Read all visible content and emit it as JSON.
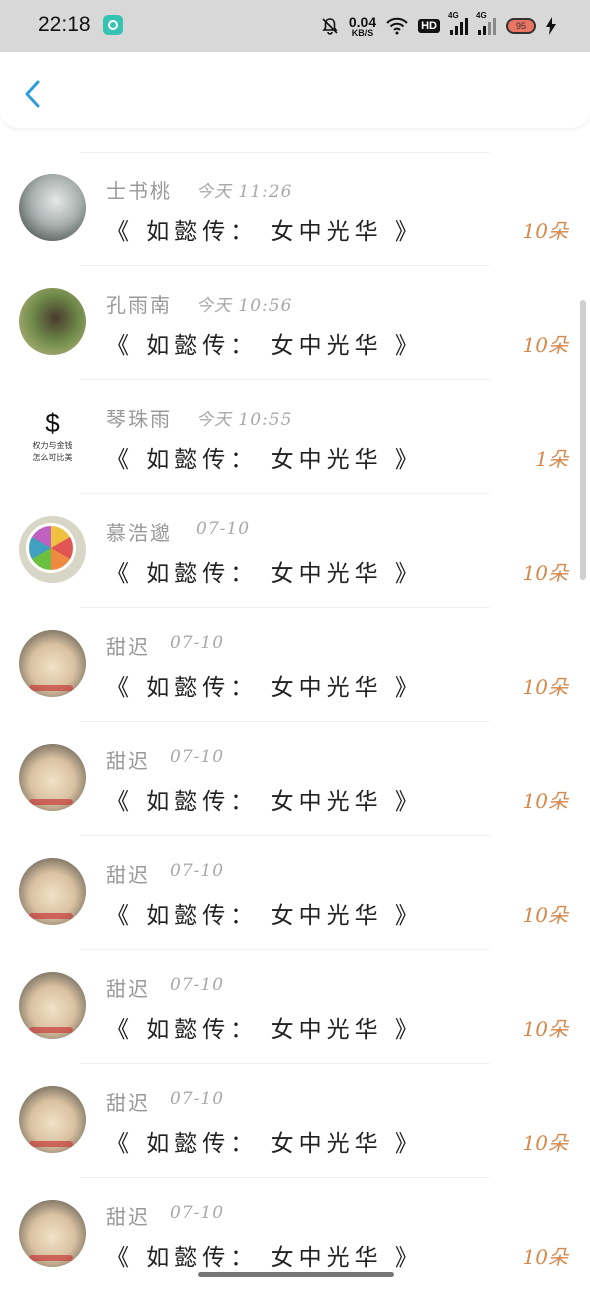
{
  "status_bar": {
    "time": "22:18",
    "net_speed": "0.04",
    "net_unit": "KB/S",
    "hd": "HD",
    "sig1": "4G",
    "sig2": "4G",
    "battery": "95"
  },
  "list": [
    {
      "name": "士书桃",
      "time": "今天 11:26",
      "title": "《 如懿传： 女中光华 》",
      "count": "10朵",
      "avatar": "photo-girl"
    },
    {
      "name": "孔雨南",
      "time": "今天 10:56",
      "title": "《 如懿传： 女中光华 》",
      "count": "10朵",
      "avatar": "photo-girl-garden"
    },
    {
      "name": "琴珠雨",
      "time": "今天 10:55",
      "title": "《 如懿传： 女中光华 》",
      "count": "1朵",
      "avatar": "dollar",
      "avatar_caption_1": "权力与金钱",
      "avatar_caption_2": "怎么可比美"
    },
    {
      "name": "慕浩邈",
      "time": "07-10",
      "title": "《 如懿传： 女中光华 》",
      "count": "10朵",
      "avatar": "citrus-slice"
    },
    {
      "name": "甜迟",
      "time": "07-10",
      "title": "《 如懿传： 女中光华 》",
      "count": "10朵",
      "avatar": "puppy"
    },
    {
      "name": "甜迟",
      "time": "07-10",
      "title": "《 如懿传： 女中光华 》",
      "count": "10朵",
      "avatar": "puppy"
    },
    {
      "name": "甜迟",
      "time": "07-10",
      "title": "《 如懿传： 女中光华 》",
      "count": "10朵",
      "avatar": "puppy"
    },
    {
      "name": "甜迟",
      "time": "07-10",
      "title": "《 如懿传： 女中光华 》",
      "count": "10朵",
      "avatar": "puppy"
    },
    {
      "name": "甜迟",
      "time": "07-10",
      "title": "《 如懿传： 女中光华 》",
      "count": "10朵",
      "avatar": "puppy"
    },
    {
      "name": "甜迟",
      "time": "07-10",
      "title": "《 如懿传： 女中光华 》",
      "count": "10朵",
      "avatar": "puppy"
    }
  ],
  "colors": {
    "accent_back": "#2d9cdb",
    "count": "#d6874a",
    "name": "#9a9a9a"
  }
}
